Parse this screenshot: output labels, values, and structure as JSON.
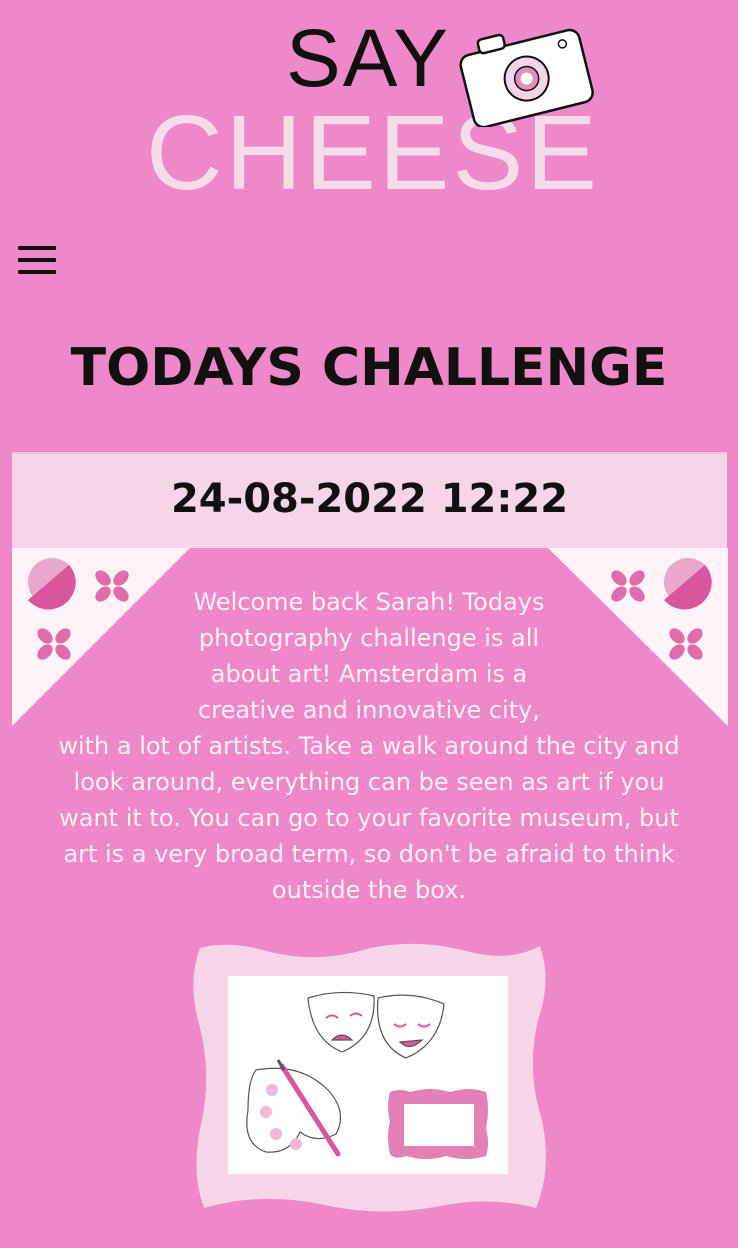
{
  "header": {
    "logo_top": "SAY",
    "logo_bottom": "CHEESE"
  },
  "menu": {
    "icon": "hamburger-menu-icon"
  },
  "challenge": {
    "title": "TODAYS CHALLENGE",
    "datetime": "24-08-2022 12:22",
    "description_lines": [
      "Welcome back Sarah! Todays",
      "photography challenge is all",
      "about art! Amsterdam is a",
      "creative and innovative city,",
      "with a lot of artists. Take a walk around the city and",
      "look around, everything can be seen as art if you",
      "want it to. You can go to your favorite museum, but",
      "art is a very broad term, so don't be afraid to think",
      "outside the box."
    ]
  },
  "colors": {
    "background": "#ee88c9",
    "banner": "#f6d5e8",
    "accent_dark": "#d9569c",
    "light_pink": "#f6dceb"
  },
  "illustration": {
    "icon": "art-frame-masks-palette-illustration"
  }
}
